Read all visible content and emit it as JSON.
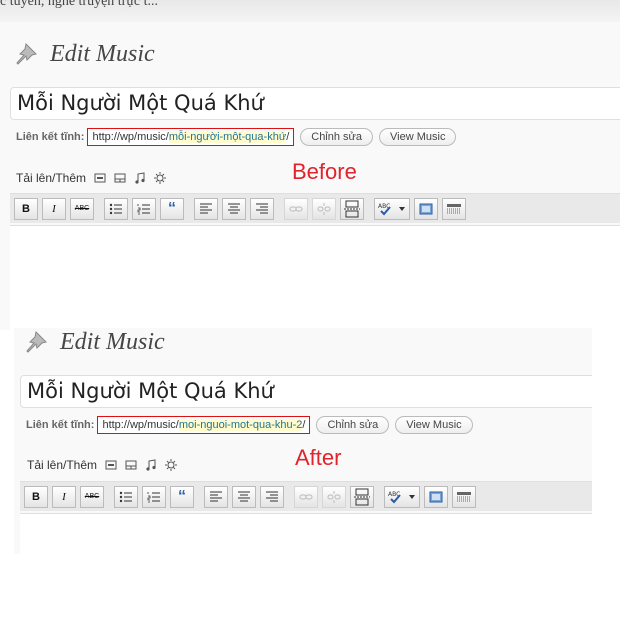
{
  "before": {
    "top_clip_text": "c tuyến, nghe truyện trực t...",
    "heading": "Edit Music",
    "post_title": "Mỗi Người Một Quá Khứ",
    "permalink_label": "Liên kết tĩnh:",
    "permalink_base": "http://wp/music/",
    "permalink_slug": "mỗi-người-một-qua-khứ",
    "permalink_trailing": "/",
    "edit_button": "Chỉnh sửa",
    "view_button": "View Music",
    "upload_label": "Tải lên/Thêm",
    "annotation": "Before"
  },
  "after": {
    "heading": "Edit Music",
    "post_title": "Mỗi Người Một Quá Khứ",
    "permalink_label": "Liên kết tĩnh:",
    "permalink_base": "http://wp/music/",
    "permalink_slug": "moi-nguoi-mot-qua-khu-2",
    "permalink_trailing": "/",
    "edit_button": "Chỉnh sửa",
    "view_button": "View Music",
    "upload_label": "Tải lên/Thêm",
    "annotation": "After"
  },
  "toolbar": {
    "bold": "B",
    "italic": "I",
    "strike": "ABC",
    "quote": "“"
  },
  "icons": [
    "pushpin-icon",
    "image-icon",
    "video-icon",
    "audio-icon",
    "media-icon",
    "bold-icon",
    "italic-icon",
    "strikethrough-icon",
    "bullet-list-icon",
    "numbered-list-icon",
    "blockquote-icon",
    "align-left-icon",
    "align-center-icon",
    "align-right-icon",
    "link-icon",
    "unlink-icon",
    "more-tag-icon",
    "spellcheck-icon",
    "fullscreen-icon",
    "kitchen-sink-icon"
  ],
  "colors": {
    "annotation": "#e0242b",
    "permalink_border": "#dd1111",
    "slug_highlight": "#fffbcc"
  }
}
